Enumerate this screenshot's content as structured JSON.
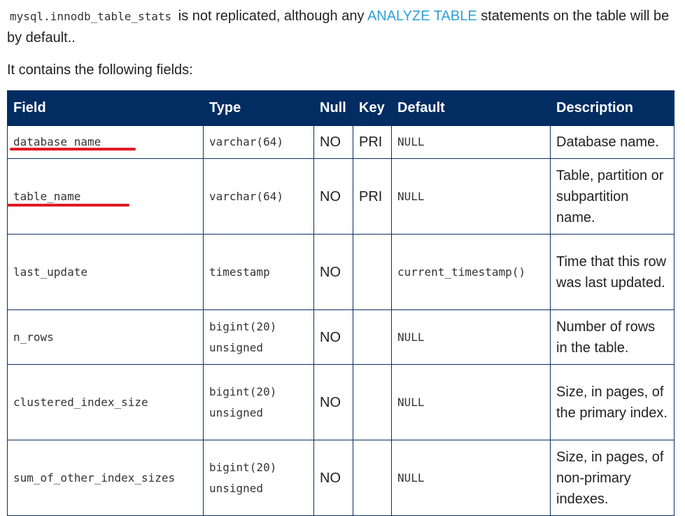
{
  "intro": {
    "code": "mysql.innodb_table_stats",
    "text_before_link": " is not replicated, although any ",
    "link": "ANALYZE TABLE",
    "text_after_link": " statements on the table will be by default.."
  },
  "lead": "It contains the following fields:",
  "table": {
    "headers": {
      "field": "Field",
      "type": "Type",
      "null": "Null",
      "key": "Key",
      "default": "Default",
      "description": "Description"
    },
    "rows": [
      {
        "field": "database_name",
        "type1": "varchar(64)",
        "type2": "",
        "null": "NO",
        "key": "PRI",
        "default": "NULL",
        "description": "Database name."
      },
      {
        "field": "table_name",
        "type1": "varchar(64)",
        "type2": "",
        "null": "NO",
        "key": "PRI",
        "default": "NULL",
        "description": "Table, partition or subpartition name."
      },
      {
        "field": "last_update",
        "type1": "timestamp",
        "type2": "",
        "null": "NO",
        "key": "",
        "default": "current_timestamp()",
        "description": "Time that this row was last updated."
      },
      {
        "field": "n_rows",
        "type1": "bigint(20)",
        "type2": "unsigned",
        "null": "NO",
        "key": "",
        "default": "NULL",
        "description": "Number of rows in the table."
      },
      {
        "field": "clustered_index_size",
        "type1": "bigint(20)",
        "type2": "unsigned",
        "null": "NO",
        "key": "",
        "default": "NULL",
        "description": "Size, in pages, of the primary index."
      },
      {
        "field": "sum_of_other_index_sizes",
        "type1": "bigint(20)",
        "type2": "unsigned",
        "null": "NO",
        "key": "",
        "default": "NULL",
        "description": "Size, in pages, of non-primary indexes."
      }
    ]
  },
  "annotation_color": "#e01b24"
}
